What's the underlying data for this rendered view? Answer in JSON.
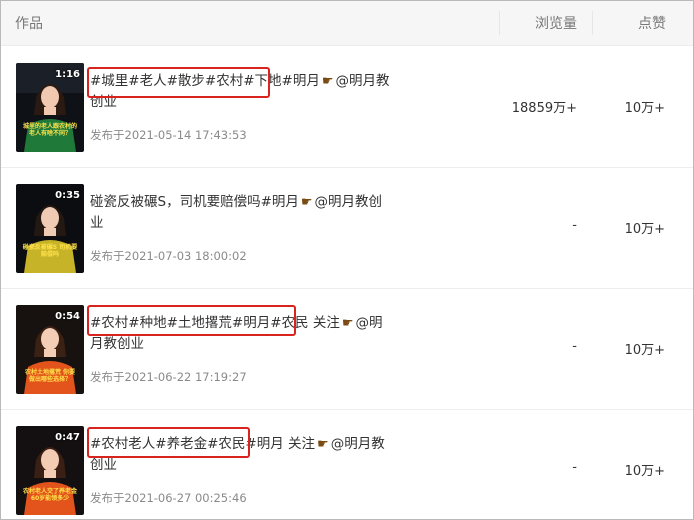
{
  "header": {
    "works": "作品",
    "views": "浏览量",
    "likes": "点赞"
  },
  "rows": [
    {
      "duration": "1:16",
      "caption": "城里的老人跟农村的老人有啥不同？",
      "title_part1": "#城里#老人#散步#农村#下地#明月",
      "title_part2": "@明月教创业",
      "date": "发布于2021-05-14 17:43:53",
      "views": "18859万+",
      "likes": "10万+",
      "outfit_color": "#1f7a3a"
    },
    {
      "duration": "0:35",
      "caption": "碰瓷反被碾S 司机要赔偿吗",
      "title_part1": "碰瓷反被碾S，司机要赔偿吗#明月",
      "title_part2": "@明月教创业",
      "date": "发布于2021-07-03 18:00:02",
      "views": "-",
      "likes": "10万+",
      "outfit_color": "#c7b327"
    },
    {
      "duration": "0:54",
      "caption": "农村土地撂荒 你要做出哪些选择？",
      "title_part1": "#农村#种地#土地撂荒#明月#农民 关注",
      "title_part2": "@明月教创业",
      "date": "发布于2021-06-22 17:19:27",
      "views": "-",
      "likes": "10万+",
      "outfit_color": "#e2541b"
    },
    {
      "duration": "0:47",
      "caption": "农村老人交了养老金 60岁能领多少",
      "title_part1": "#农村老人#养老金#农民#明月 关注",
      "title_part2": "@明月教创业",
      "date": "发布于2021-06-27 00:25:46",
      "views": "-",
      "likes": "10万+",
      "outfit_color": "#e2541b"
    }
  ],
  "pointer_icon": "pointing-hand-icon",
  "highlight_color": "#d9231f"
}
